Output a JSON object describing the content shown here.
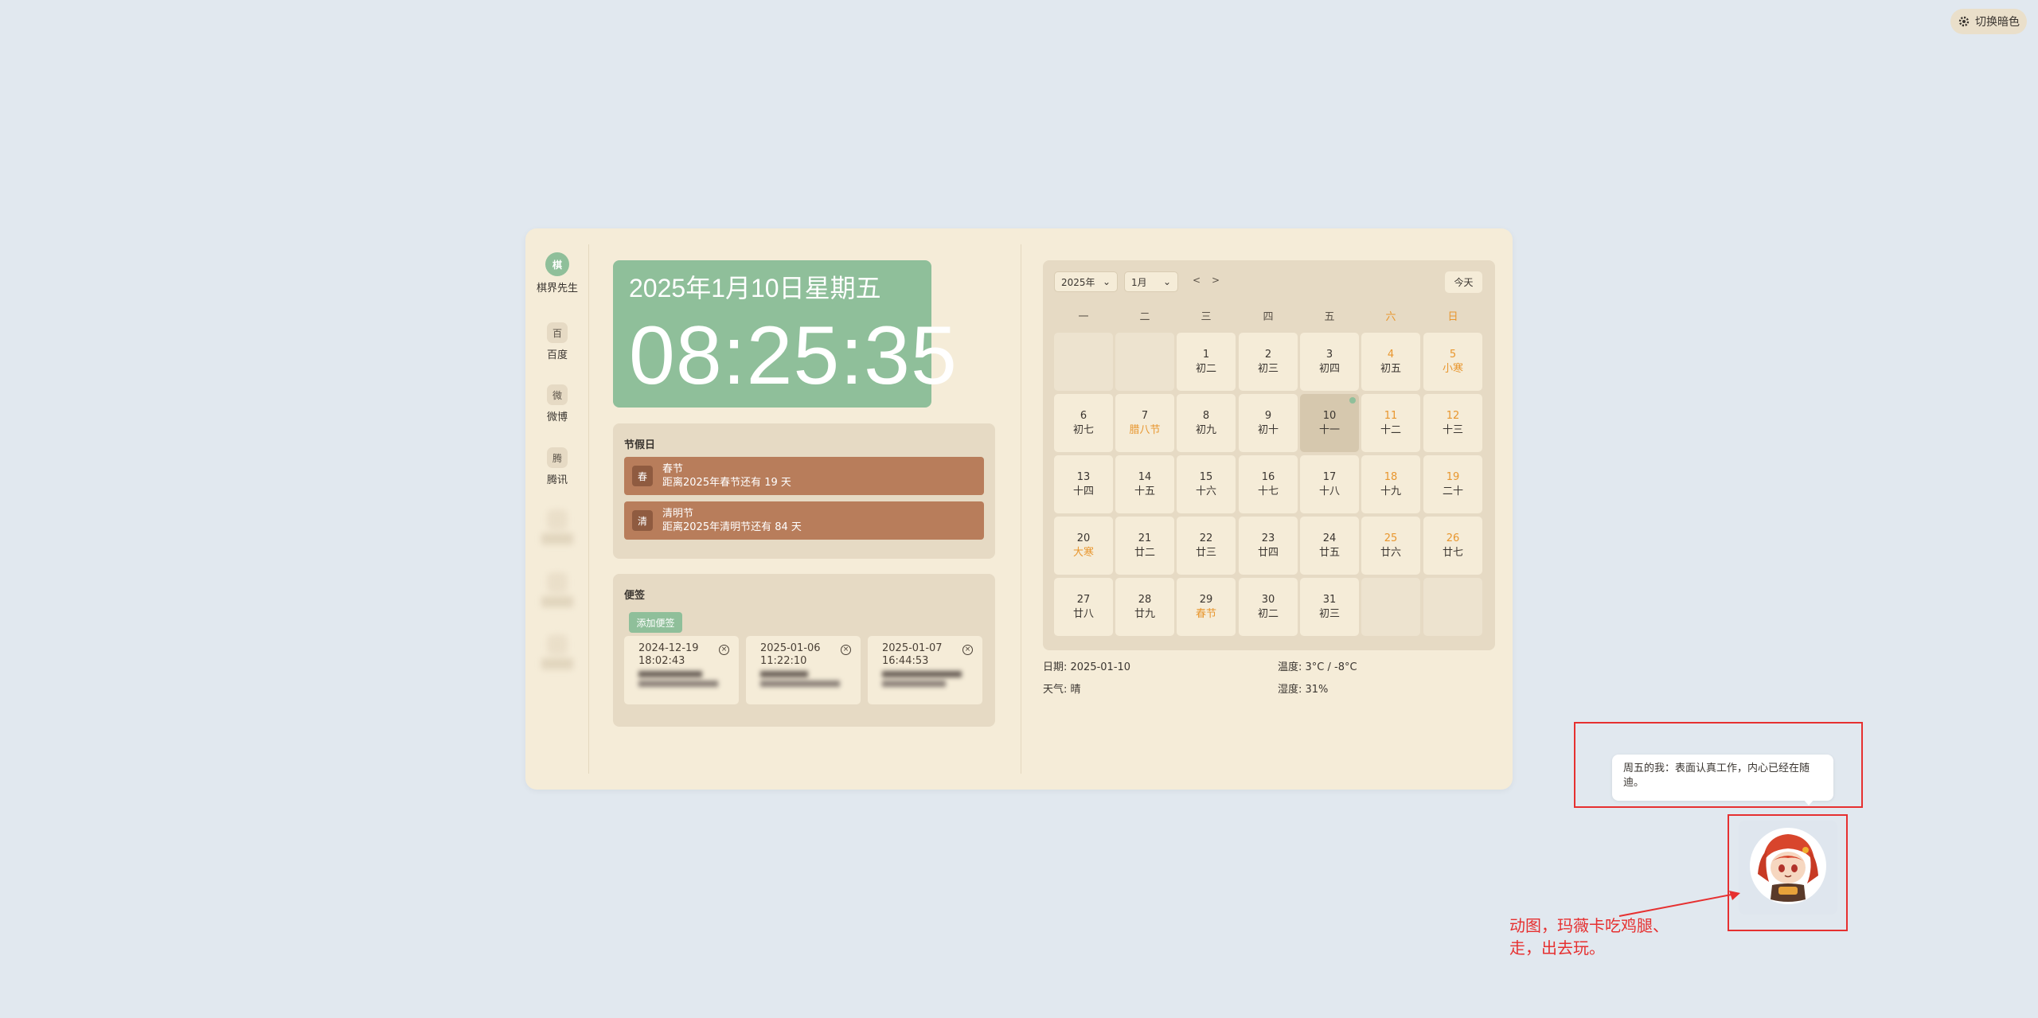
{
  "theme_toggle": {
    "label": "切换暗色",
    "icon": "gear-icon"
  },
  "sidebar": {
    "items": [
      {
        "icon_text": "棋",
        "label": "棋界先生"
      },
      {
        "icon_text": "百",
        "label": "百度"
      },
      {
        "icon_text": "微",
        "label": "微博"
      },
      {
        "icon_text": "腾",
        "label": "腾讯"
      },
      {
        "icon_text": "",
        "label": ""
      },
      {
        "icon_text": "",
        "label": ""
      },
      {
        "icon_text": "",
        "label": ""
      }
    ]
  },
  "clock": {
    "date": "2025年1月10日星期五",
    "time": "08:25:35"
  },
  "holidays": {
    "title": "节假日",
    "items": [
      {
        "badge": "春",
        "name": "春节",
        "countdown": "距离2025年春节还有 19 天"
      },
      {
        "badge": "清",
        "name": "清明节",
        "countdown": "距离2025年清明节还有 84 天"
      }
    ]
  },
  "notes": {
    "title": "便签",
    "add_label": "添加便签",
    "items": [
      {
        "date": "2024-12-19",
        "time": "18:02:43",
        "content": ""
      },
      {
        "date": "2025-01-06",
        "time": "11:22:10",
        "content": ""
      },
      {
        "date": "2025-01-07",
        "time": "16:44:53",
        "content": ""
      }
    ]
  },
  "calendar": {
    "year_select": "2025年",
    "month_select": "1月",
    "prev": "<",
    "next": ">",
    "today_label": "今天",
    "weekdays": [
      "一",
      "二",
      "三",
      "四",
      "五",
      "六",
      "日"
    ],
    "days": [
      {
        "d": "",
        "l": ""
      },
      {
        "d": "",
        "l": ""
      },
      {
        "d": "1",
        "l": "初二"
      },
      {
        "d": "2",
        "l": "初三"
      },
      {
        "d": "3",
        "l": "初四"
      },
      {
        "d": "4",
        "l": "初五"
      },
      {
        "d": "5",
        "l": "小寒"
      },
      {
        "d": "6",
        "l": "初七"
      },
      {
        "d": "7",
        "l": "腊八节"
      },
      {
        "d": "8",
        "l": "初九"
      },
      {
        "d": "9",
        "l": "初十"
      },
      {
        "d": "10",
        "l": "十一"
      },
      {
        "d": "11",
        "l": "十二"
      },
      {
        "d": "12",
        "l": "十三"
      },
      {
        "d": "13",
        "l": "十四"
      },
      {
        "d": "14",
        "l": "十五"
      },
      {
        "d": "15",
        "l": "十六"
      },
      {
        "d": "16",
        "l": "十七"
      },
      {
        "d": "17",
        "l": "十八"
      },
      {
        "d": "18",
        "l": "十九"
      },
      {
        "d": "19",
        "l": "二十"
      },
      {
        "d": "20",
        "l": "大寒"
      },
      {
        "d": "21",
        "l": "廿二"
      },
      {
        "d": "22",
        "l": "廿三"
      },
      {
        "d": "23",
        "l": "廿四"
      },
      {
        "d": "24",
        "l": "廿五"
      },
      {
        "d": "25",
        "l": "廿六"
      },
      {
        "d": "26",
        "l": "廿七"
      },
      {
        "d": "27",
        "l": "廿八"
      },
      {
        "d": "28",
        "l": "廿九"
      },
      {
        "d": "29",
        "l": "春节"
      },
      {
        "d": "30",
        "l": "初二"
      },
      {
        "d": "31",
        "l": "初三"
      },
      {
        "d": "",
        "l": ""
      },
      {
        "d": "",
        "l": ""
      }
    ],
    "today": "10",
    "festival_labels": [
      "小寒",
      "腊八节",
      "大寒",
      "春节"
    ]
  },
  "info": {
    "date": "日期: 2025-01-10",
    "temperature": "温度: 3°C / -8°C",
    "weather": "天气: 晴",
    "humidity": "湿度: 31%"
  },
  "pet": {
    "bubble": "周五的我：表面认真工作，内心已经在随迪。",
    "annotation_line1": "动图，玛薇卡吃鸡腿、",
    "annotation_line2": "走，出去玩。"
  },
  "colors": {
    "background": "#e1e8ef",
    "card": "#f5ecd8",
    "accent_green": "#8fbf9a",
    "holiday": "#b87d5b",
    "weekend": "#e8962e",
    "annotation_red": "#e63030"
  }
}
